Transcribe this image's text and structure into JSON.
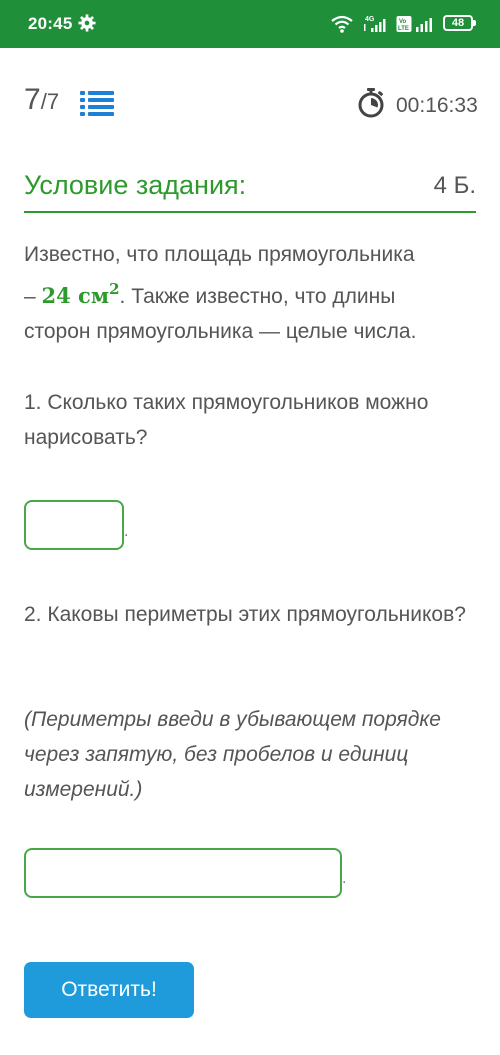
{
  "status_bar": {
    "time": "20:45",
    "network": "4G",
    "volte": "Vo LTE",
    "battery": "48"
  },
  "header": {
    "current": "7",
    "total": "7",
    "timer": "00:16:33"
  },
  "task": {
    "title": "Условие задания:",
    "points": "4 Б.",
    "intro_1": "Известно, что площадь прямоугольника",
    "intro_dash": "– ",
    "area_value": "24 см",
    "area_exp": "2",
    "intro_2": ". Также известно, что длины",
    "intro_3": "сторон прямоугольника — целые числа.",
    "question_1": "1. Сколько таких прямоугольников можно нарисовать?",
    "question_2": "2. Каковы периметры этих прямоугольников?",
    "hint": "(Периметры введи в убывающем порядке через запятую, без пробелов и единиц измерений.)",
    "dot": "."
  },
  "answers": {
    "answer_1": "",
    "answer_2": ""
  },
  "submit_label": "Ответить!",
  "colors": {
    "status_bar": "#1f8f3a",
    "accent_green": "#2e9a2e",
    "button_blue": "#1f9bdc"
  }
}
